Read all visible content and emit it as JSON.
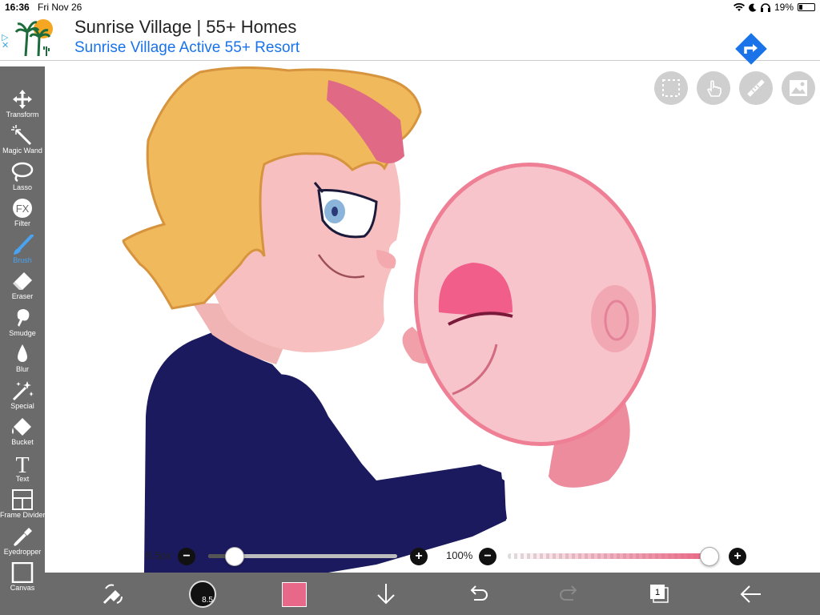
{
  "status_bar": {
    "time": "16:36",
    "date": "Fri Nov 26",
    "battery": "19%",
    "battery_level": 0.19
  },
  "ad": {
    "adchoices_icon": "ad-choices-icon",
    "headline": "Sunrise Village | 55+ Homes",
    "subline": "Sunrise Village Active 55+ Resort",
    "cta_icon": "directions-arrow-icon"
  },
  "toolbar": {
    "tools": [
      {
        "label": "Transform",
        "icon": "move-arrows-icon"
      },
      {
        "label": "Magic Wand",
        "icon": "magic-wand-icon"
      },
      {
        "label": "Lasso",
        "icon": "lasso-icon"
      },
      {
        "label": "Filter",
        "icon": "fx-icon",
        "glyph": "FX"
      },
      {
        "label": "Brush",
        "icon": "brush-icon",
        "active": true
      },
      {
        "label": "Eraser",
        "icon": "eraser-icon"
      },
      {
        "label": "Smudge",
        "icon": "smudge-icon"
      },
      {
        "label": "Blur",
        "icon": "drop-icon"
      },
      {
        "label": "Special",
        "icon": "sparkle-wand-icon"
      },
      {
        "label": "Bucket",
        "icon": "bucket-icon"
      },
      {
        "label": "Text",
        "icon": "text-icon",
        "glyph": "T"
      },
      {
        "label": "Frame Divider",
        "icon": "frame-divider-icon"
      },
      {
        "label": "Eyedropper",
        "icon": "eyedropper-icon"
      },
      {
        "label": "Canvas",
        "icon": "canvas-icon"
      }
    ]
  },
  "canvas_buttons": [
    {
      "icon": "selection-icon"
    },
    {
      "icon": "touch-icon"
    },
    {
      "icon": "ruler-icon"
    },
    {
      "icon": "image-icon"
    }
  ],
  "brush_controls": {
    "size_label": "8.5px",
    "size_fraction": 0.14,
    "opacity_label": "100%",
    "opacity_fraction": 1.0,
    "minus": "−",
    "plus": "+"
  },
  "bottom_bar": {
    "brush_size_badge": "8.5",
    "color": "#e8688a",
    "layer_count": "1"
  },
  "colors": {
    "toolbar_bg": "#6b6b6b",
    "active_tool": "#4aa3f0",
    "shirt": "#1c1a5e",
    "hair": "#f0b95c",
    "skin": "#f7bfbf",
    "kirby": "#f8c4cc"
  }
}
